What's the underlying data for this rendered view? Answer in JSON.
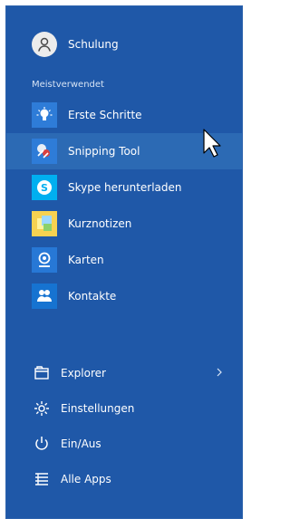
{
  "start_menu": {
    "user": {
      "name": "Schulung"
    },
    "section_title": "Meistverwendet",
    "apps": [
      {
        "label": "Erste Schritte",
        "icon": "lightbulb-icon"
      },
      {
        "label": "Snipping Tool",
        "icon": "snipping-tool-icon"
      },
      {
        "label": "Skype herunterladen",
        "icon": "skype-icon"
      },
      {
        "label": "Kurznotizen",
        "icon": "sticky-notes-icon"
      },
      {
        "label": "Karten",
        "icon": "maps-icon"
      },
      {
        "label": "Kontakte",
        "icon": "contacts-icon"
      }
    ],
    "system_items": [
      {
        "label": "Explorer",
        "icon": "folder-icon",
        "has_submenu": true
      },
      {
        "label": "Einstellungen",
        "icon": "gear-icon"
      },
      {
        "label": "Ein/Aus",
        "icon": "power-icon"
      },
      {
        "label": "Alle Apps",
        "icon": "list-icon"
      }
    ]
  },
  "colors": {
    "menu_background": "#1f58a8",
    "hover_background": "#2c6ab4",
    "text": "#ffffff"
  }
}
